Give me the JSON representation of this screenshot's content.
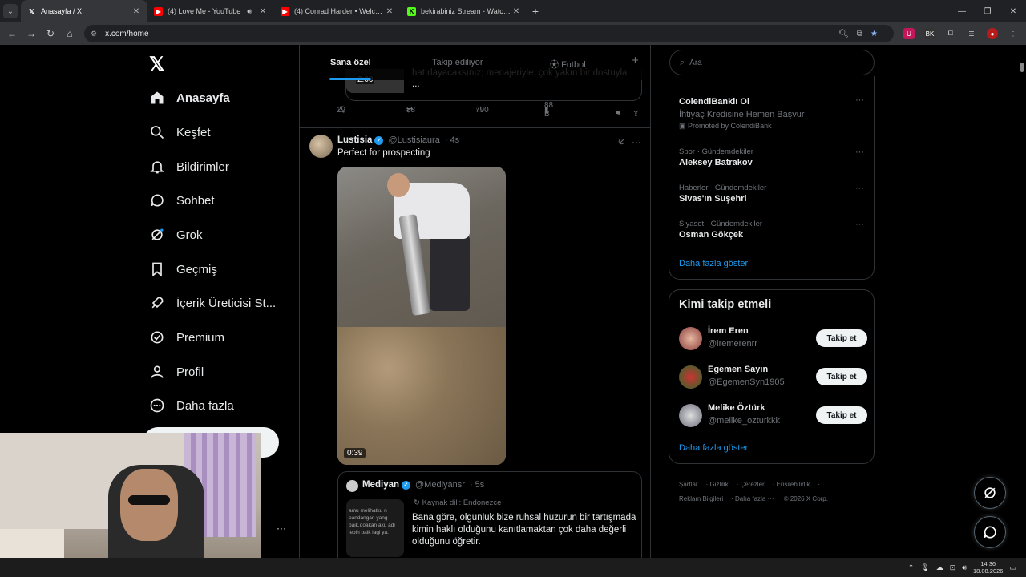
{
  "browser": {
    "tabs": [
      {
        "title": "Anasayfa / X",
        "favicon": "X",
        "active": true
      },
      {
        "title": "(4) Love Me - YouTube",
        "favicon": "YT",
        "audio": true
      },
      {
        "title": "(4) Conrad Harder • Welcome",
        "favicon": "YT"
      },
      {
        "title": "bekirabiniz Stream - Watch Live",
        "favicon": "K"
      }
    ],
    "url": "x.com/home"
  },
  "sidebar": {
    "items": [
      {
        "label": "Anasayfa",
        "icon": "home-icon"
      },
      {
        "label": "Keşfet",
        "icon": "search-icon"
      },
      {
        "label": "Bildirimler",
        "icon": "bell-icon"
      },
      {
        "label": "Sohbet",
        "icon": "chat-icon"
      },
      {
        "label": "Grok",
        "icon": "grok-icon"
      },
      {
        "label": "Geçmiş",
        "icon": "bookmark-icon"
      },
      {
        "label": "İçerik Üreticisi St...",
        "icon": "rocket-icon"
      },
      {
        "label": "Premium",
        "icon": "verified-icon"
      },
      {
        "label": "Profil",
        "icon": "person-icon"
      },
      {
        "label": "Daha fazla",
        "icon": "more-icon"
      }
    ]
  },
  "feed": {
    "tabs": [
      "Sana özel",
      "Takip ediliyor",
      "Futbol"
    ],
    "prev_post": {
      "duration": "2:00",
      "text_line1": "hatırlayacaksınız; menajeriyle, çok yakın bir dostuyla ...",
      "replies": "29",
      "reposts": "88",
      "likes": "790",
      "views": "88 B"
    },
    "post": {
      "name": "Lustisia",
      "handle": "@Lustisiaura",
      "time": "· 4s",
      "text": "Perfect for prospecting",
      "duration": "0:39"
    },
    "quote": {
      "name": "Mediyan",
      "handle": "@Mediyansr",
      "time": "· 5s",
      "source": "Kaynak dili: Endonezce",
      "thumb_text": "amu melihatku n pandangan yang baik,doakan aku adi lebih baik lagi ya.",
      "text": "Bana göre, olgunluk bize ruhsal huzurun bir tartışmada kimin haklı olduğunu kanıtlamaktan çok daha değerli olduğunu öğretir."
    }
  },
  "right": {
    "search_placeholder": "Ara",
    "trends": [
      {
        "name": "ColendiBanklı Ol",
        "sub": "İhtiyaç Kredisine Hemen Başvur",
        "promo": "Promoted by ColendiBank"
      },
      {
        "cat": "Spor · Gündemdekiler",
        "name": "Aleksey Batrakov"
      },
      {
        "cat": "Haberler · Gündemdekiler",
        "name": "Sivas'ın Suşehri"
      },
      {
        "cat": "Siyaset · Gündemdekiler",
        "name": "Osman Gökçek"
      }
    ],
    "show_more": "Daha fazla göster",
    "who_title": "Kimi takip etmeli",
    "who": [
      {
        "name": "İrem Eren",
        "handle": "@iremerenrr"
      },
      {
        "name": "Egemen Sayın",
        "handle": "@EgemenSyn1905"
      },
      {
        "name": "Melike Öztürk",
        "handle": "@melike_ozturkkk"
      }
    ],
    "follow_label": "Takip et",
    "footer": [
      "Şartlar",
      "Gizlilik",
      "Çerezler",
      "Erişilebilirlik",
      "Reklam Bilgileri",
      "Daha fazla ···",
      "© 2026 X Corp."
    ]
  },
  "taskbar": {
    "time": "14:36",
    "date": "18.08.2026"
  }
}
